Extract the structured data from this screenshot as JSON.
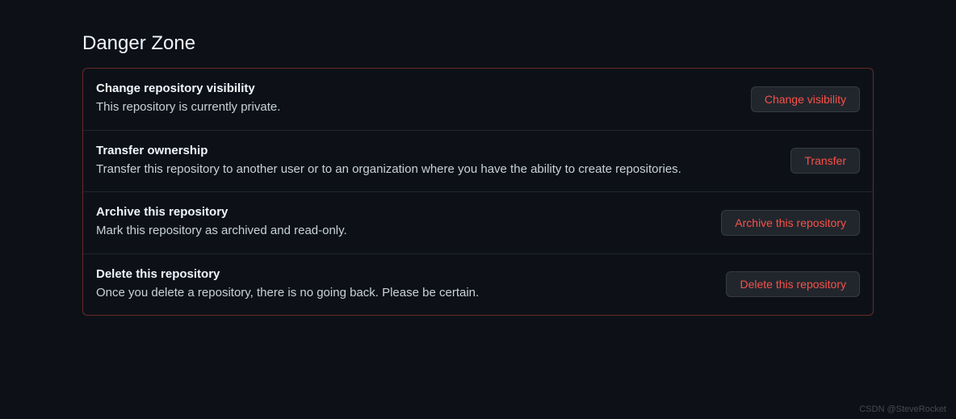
{
  "section_title": "Danger Zone",
  "items": [
    {
      "title": "Change repository visibility",
      "description": "This repository is currently private.",
      "button": "Change visibility"
    },
    {
      "title": "Transfer ownership",
      "description": "Transfer this repository to another user or to an organization where you have the ability to create repositories.",
      "button": "Transfer"
    },
    {
      "title": "Archive this repository",
      "description": "Mark this repository as archived and read-only.",
      "button": "Archive this repository"
    },
    {
      "title": "Delete this repository",
      "description": "Once you delete a repository, there is no going back. Please be certain.",
      "button": "Delete this repository"
    }
  ],
  "watermark": "CSDN @SteveRocket"
}
